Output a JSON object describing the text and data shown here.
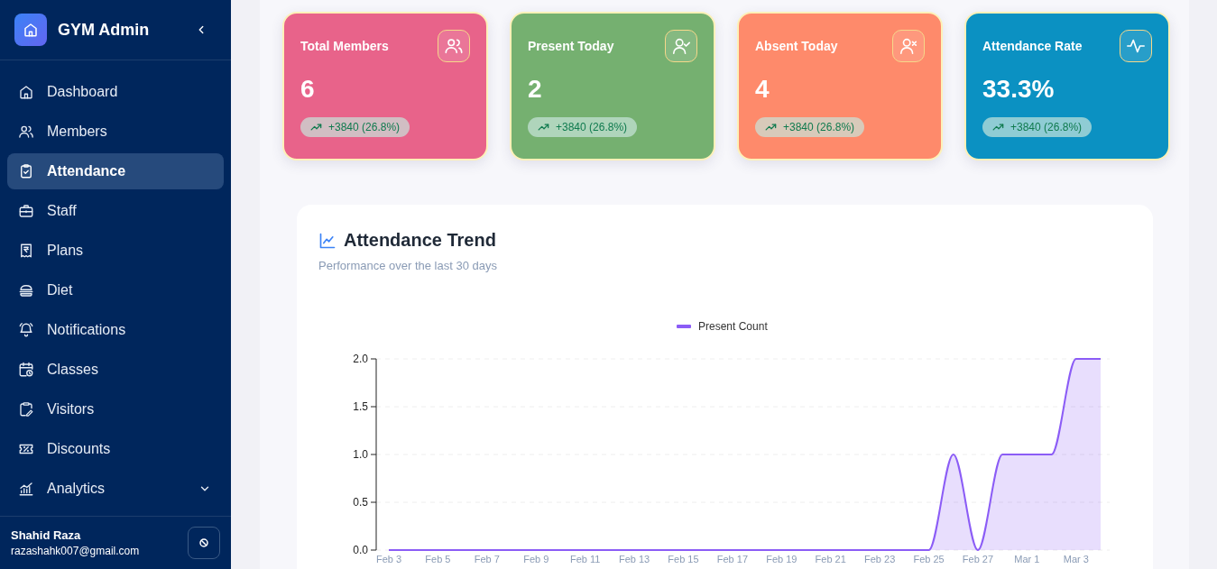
{
  "sidebar": {
    "brand": "GYM Admin",
    "items": [
      {
        "label": "Dashboard",
        "kind": "link",
        "selected": false
      },
      {
        "label": "Members",
        "kind": "link",
        "selected": false
      },
      {
        "label": "Attendance",
        "kind": "link",
        "selected": true
      },
      {
        "label": "Staff",
        "kind": "link",
        "selected": false
      },
      {
        "label": "Plans",
        "kind": "link",
        "selected": false
      },
      {
        "label": "Diet",
        "kind": "link",
        "selected": false
      },
      {
        "label": "Notifications",
        "kind": "link",
        "selected": false
      },
      {
        "label": "Classes",
        "kind": "link",
        "selected": false
      },
      {
        "label": "Visitors",
        "kind": "link",
        "selected": false
      },
      {
        "label": "Discounts",
        "kind": "link",
        "selected": false
      },
      {
        "label": "Analytics",
        "kind": "group",
        "selected": false,
        "expanded": false
      }
    ],
    "user": {
      "name": "Shahid Raza",
      "email": "razashahk007@gmail.com"
    }
  },
  "cards": [
    {
      "title": "Total Members",
      "value": "6",
      "change": "+3840 (26.8%)",
      "color": "#e8638a"
    },
    {
      "title": "Present Today",
      "value": "2",
      "change": "+3840 (26.8%)",
      "color": "#75b070"
    },
    {
      "title": "Absent Today",
      "value": "4",
      "change": "+3840 (26.8%)",
      "color": "#fe8a6b"
    },
    {
      "title": "Attendance Rate",
      "value": "33.3%",
      "change": "+3840 (26.8%)",
      "color": "#0b91c2"
    }
  ],
  "trend": {
    "title": "Attendance Trend",
    "subtitle": "Performance over the last 30 days",
    "chart_data": {
      "type": "area",
      "categories": [
        "Feb 3",
        null,
        "Feb 5",
        null,
        "Feb 7",
        null,
        "Feb 9",
        null,
        "Feb 11",
        null,
        "Feb 13",
        null,
        "Feb 15",
        null,
        "Feb 17",
        null,
        "Feb 19",
        null,
        "Feb 21",
        null,
        "Feb 23",
        null,
        "Feb 25",
        null,
        "Feb 27",
        null,
        "Mar 1",
        null,
        "Mar 3",
        null
      ],
      "series": [
        {
          "name": "Present Count",
          "color": "#8b5cf6",
          "values": [
            0,
            0,
            0,
            0,
            0,
            0,
            0,
            0,
            0,
            0,
            0,
            0,
            0,
            0,
            0,
            0,
            0,
            0,
            0,
            0,
            0,
            0,
            0,
            1,
            0,
            1,
            1,
            1,
            2,
            2
          ]
        }
      ],
      "grid": true,
      "ylim": [
        0,
        2
      ],
      "yticks": [
        {
          "value": 0,
          "label": "0.0"
        },
        {
          "value": 0.5,
          "label": "0.5"
        },
        {
          "value": 1,
          "label": "1.0"
        },
        {
          "value": 1.5,
          "label": "1.5"
        },
        {
          "value": 2,
          "label": "2.0"
        }
      ]
    }
  }
}
